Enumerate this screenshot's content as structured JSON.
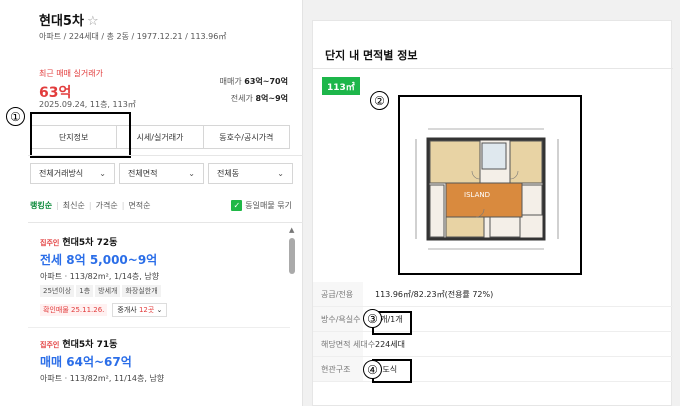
{
  "complex": {
    "name": "현대5차",
    "meta": "아파트 / 224세대 / 총 2동 / 1977.12.21 / 113.96㎡"
  },
  "recent": {
    "label": "최근 매매 실거래가",
    "price": "63억",
    "date": "2025.09.24, 11층, 113㎡",
    "sale_label": "매매가",
    "sale_range": "63억~70억",
    "rent_label": "전세가",
    "rent_range": "8억~9억"
  },
  "tabs": [
    "단지정보",
    "시세/실거래가",
    "동호수/공시가격"
  ],
  "filters": [
    "전체거래방식",
    "전체면적",
    "전체동"
  ],
  "sort": {
    "options": [
      "랭킹순",
      "최신순",
      "가격순",
      "면적순"
    ],
    "same_listing": "동일매물 묶기"
  },
  "listings": [
    {
      "badge": "집주인",
      "title": "현대5차 72동",
      "price": "전세 8억 5,000~9억",
      "desc": "아파트 · 113/82m², 1/14층, 남향",
      "tags": [
        "25년이상",
        "1층",
        "방세개",
        "화장실한개"
      ],
      "confirm_date": "확인매물 25.11.26.",
      "agency_label": "중개사",
      "agency_count": "12곳"
    },
    {
      "badge": "집주인",
      "title": "현대5차 71동",
      "price": "매매 64억~67억",
      "desc": "아파트 · 113/82m², 11/14층, 남향"
    }
  ],
  "detail": {
    "heading": "단지 내 면적별 정보",
    "area_badge": "113㎡",
    "plan_text": "ISLAND",
    "rows": [
      {
        "key": "공급/전용",
        "value": "113.96㎡/82.23㎡(전용률 72%)"
      },
      {
        "key": "방수/욕실수",
        "value": "3개/1개"
      },
      {
        "key": "해당면적 세대수",
        "value": "224세대"
      },
      {
        "key": "현관구조",
        "value": "복도식"
      }
    ]
  },
  "annotations": [
    "①",
    "②",
    "③",
    "④"
  ],
  "colors": {
    "accent_red": "#e23c3c",
    "accent_blue": "#2b6ee8",
    "accent_green": "#1db64a"
  }
}
